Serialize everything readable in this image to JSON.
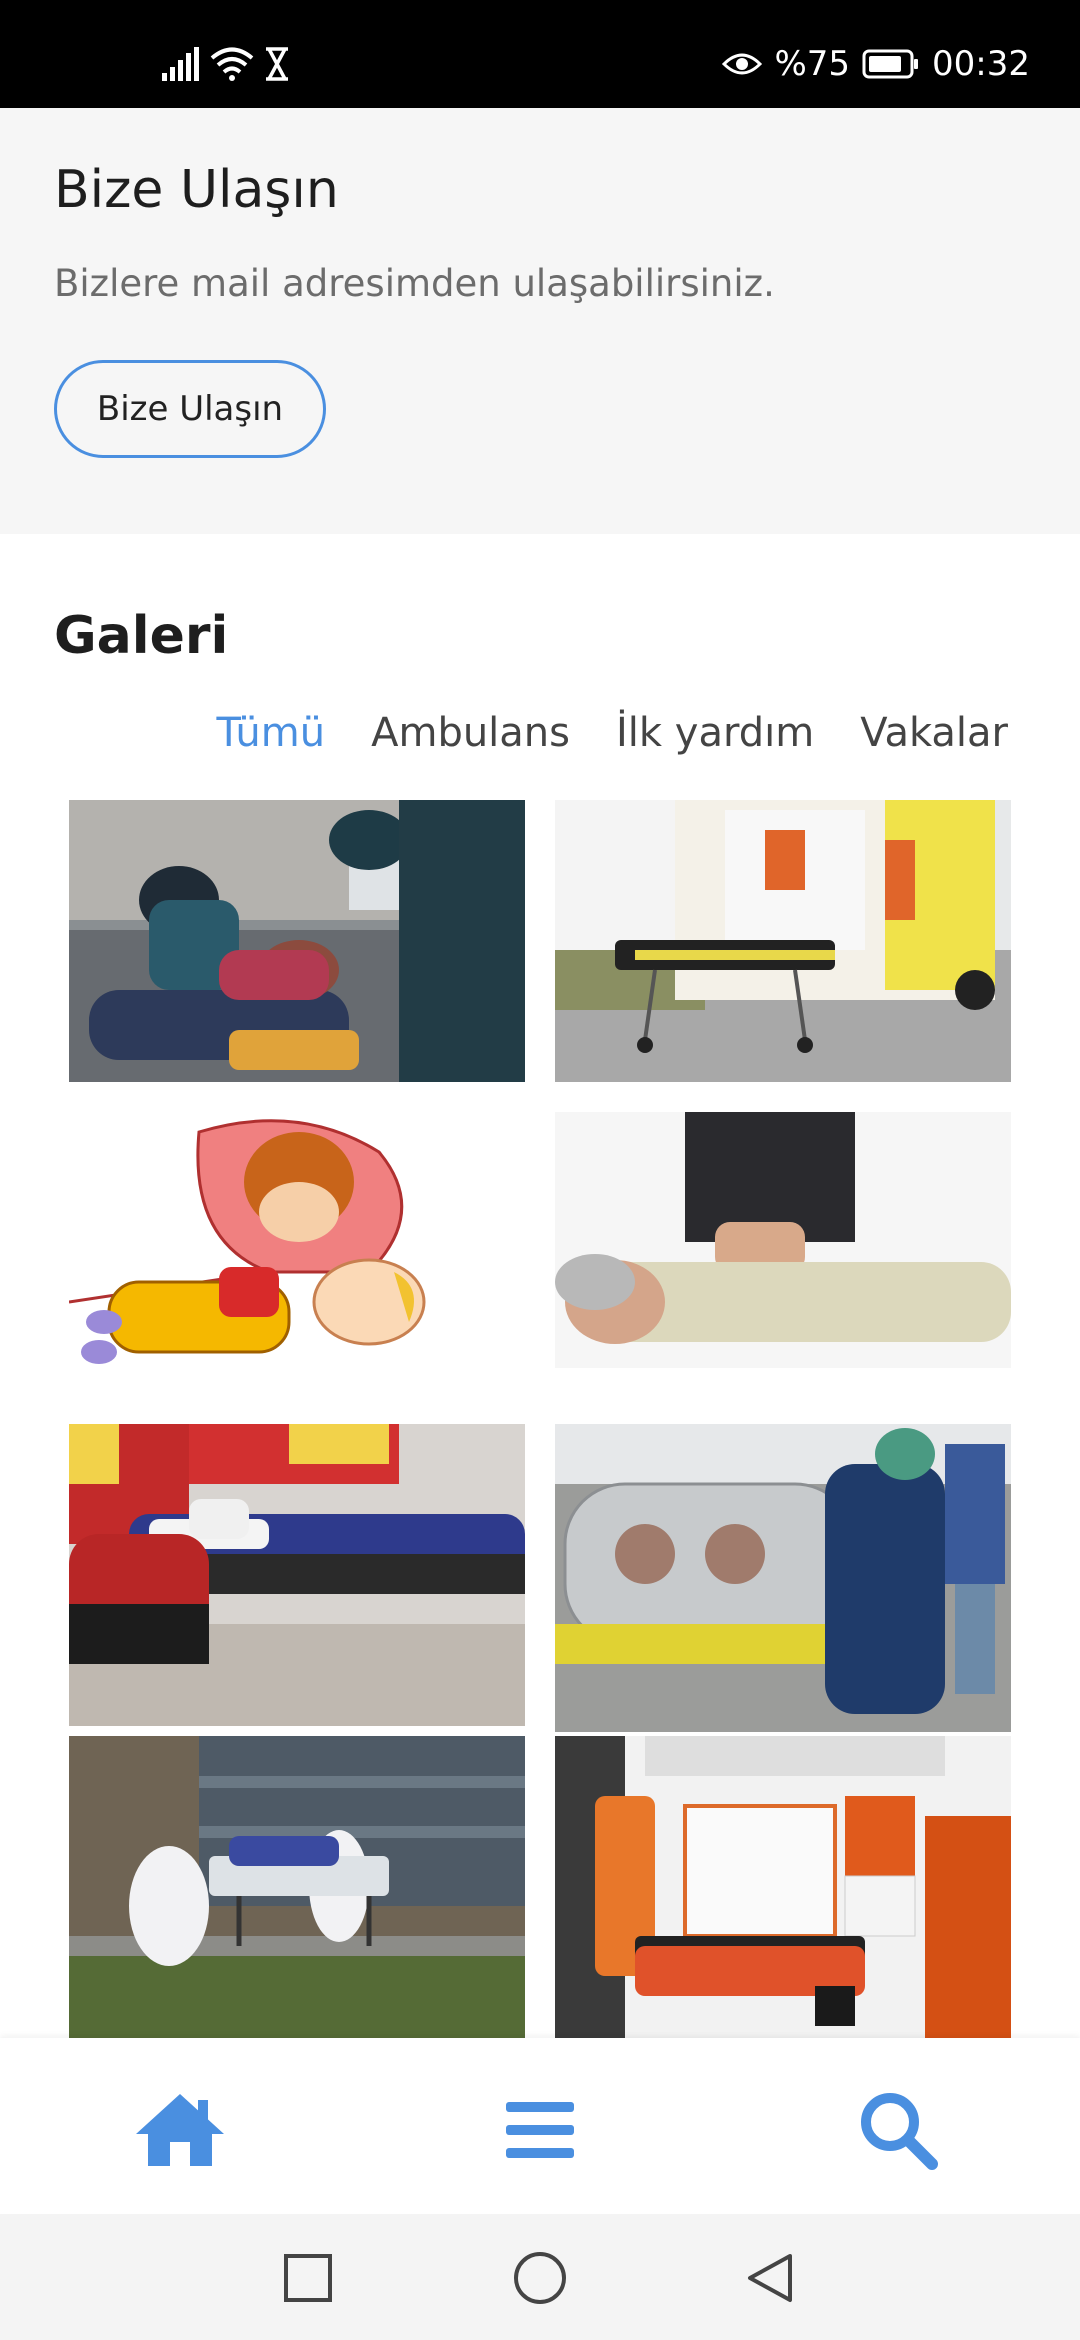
{
  "status_bar": {
    "battery_percent": "%75",
    "time": "00:32",
    "icons": [
      "signal-icon",
      "wifi-icon",
      "hourglass-icon",
      "eye-icon",
      "battery-icon"
    ]
  },
  "contact": {
    "title": "Bize Ulaşın",
    "description": "Bizlere mail adresimden ulaşabilirsiniz.",
    "button_label": "Bize Ulaşın"
  },
  "gallery": {
    "title": "Galeri",
    "filters": [
      "Tümü",
      "Ambulans",
      "İlk yardım",
      "Vakalar"
    ],
    "active_filter": "Tümü",
    "images": [
      {
        "name": "paramedics-street-photo"
      },
      {
        "name": "ambulance-stretcher-photo"
      },
      {
        "name": "cpr-child-illustration"
      },
      {
        "name": "cpr-chest-compression-photo"
      },
      {
        "name": "first-aid-leg-splint-photo"
      },
      {
        "name": "isolation-stretcher-photo"
      },
      {
        "name": "medical-team-stretcher-photo"
      },
      {
        "name": "ambulance-interior-photo"
      }
    ]
  },
  "bottom_nav": {
    "items": [
      "home-icon",
      "menu-icon",
      "search-icon"
    ],
    "accent": "#4a8fe0"
  },
  "system_nav": [
    "recents-square-icon",
    "home-circle-icon",
    "back-triangle-icon"
  ]
}
